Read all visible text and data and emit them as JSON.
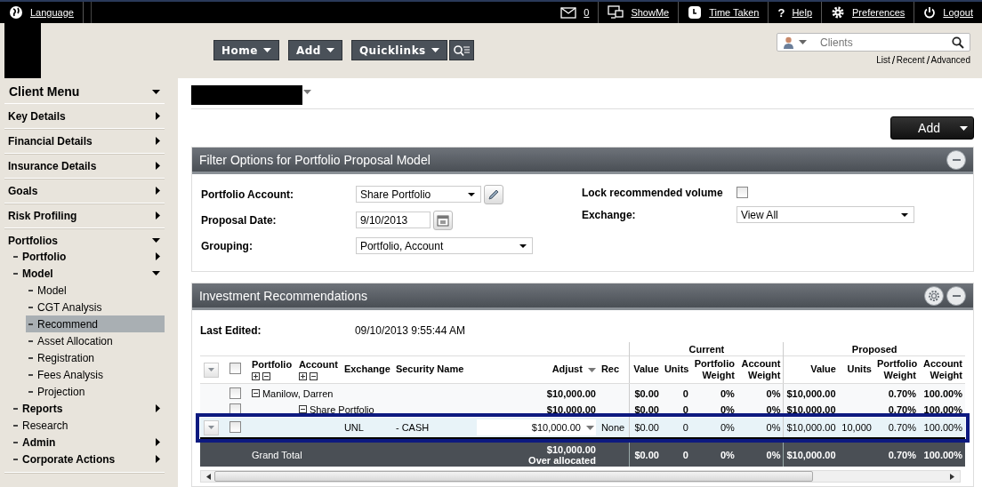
{
  "top_bar": {
    "items": [
      {
        "kind": "language",
        "label": "Language"
      },
      {
        "kind": "mail",
        "label": "0"
      },
      {
        "kind": "showme",
        "label": "ShowMe"
      },
      {
        "kind": "timer",
        "label": "Time Taken"
      },
      {
        "kind": "help",
        "glyph": "?",
        "label": "Help"
      },
      {
        "kind": "settings",
        "label": "Preferences"
      },
      {
        "kind": "logout",
        "label": "Logout"
      }
    ]
  },
  "nav": {
    "buttons": [
      "Home",
      "Add",
      "Quicklinks"
    ],
    "search": {
      "placeholder": "Clients"
    },
    "search_links": [
      "List",
      "Recent",
      "Advanced"
    ]
  },
  "sidebar": {
    "title": "Client Menu",
    "items": [
      {
        "label": "Key Details",
        "kind": "folder",
        "expanded": false,
        "selected": false
      },
      {
        "label": "Financial Details",
        "kind": "folder",
        "expanded": false,
        "selected": false
      },
      {
        "label": "Insurance Details",
        "kind": "folder",
        "expanded": false,
        "selected": false
      },
      {
        "label": "Goals",
        "kind": "folder",
        "expanded": false,
        "selected": false
      },
      {
        "label": "Risk Profiling",
        "kind": "folder",
        "expanded": false,
        "selected": false
      },
      {
        "label": "Portfolios",
        "kind": "folder",
        "expanded": true,
        "selected": false,
        "children": [
          {
            "label": "Portfolio",
            "kind": "folder",
            "expanded": false,
            "selected": false
          },
          {
            "label": "Model",
            "kind": "folder",
            "expanded": true,
            "selected": false,
            "children": [
              {
                "label": "Model",
                "kind": "page",
                "selected": false
              },
              {
                "label": "CGT Analysis",
                "kind": "page",
                "selected": false
              },
              {
                "label": "Recommend",
                "kind": "page",
                "selected": true
              },
              {
                "label": "Asset Allocation",
                "kind": "page",
                "selected": false
              },
              {
                "label": "Registration",
                "kind": "page",
                "selected": false
              },
              {
                "label": "Fees Analysis",
                "kind": "page",
                "selected": false
              },
              {
                "label": "Projection",
                "kind": "page",
                "selected": false
              }
            ]
          },
          {
            "label": "Reports",
            "kind": "folder",
            "expanded": false,
            "selected": false
          },
          {
            "label": "Research",
            "kind": "page",
            "selected": false
          },
          {
            "label": "Admin",
            "kind": "folder",
            "expanded": false,
            "selected": false
          },
          {
            "label": "Corporate Actions",
            "kind": "folder",
            "expanded": false,
            "selected": false
          }
        ]
      }
    ]
  },
  "add_button": "Add",
  "filter_panel": {
    "title": "Filter Options for Portfolio Proposal Model",
    "left_fields": [
      {
        "kind": "select",
        "label": "Portfolio Account:",
        "value": "Share Portfolio",
        "editable": true
      },
      {
        "kind": "date",
        "label": "Proposal Date:",
        "value": "9/10/2013"
      },
      {
        "kind": "select",
        "label": "Grouping:",
        "value": "Portfolio, Account"
      }
    ],
    "right_fields": [
      {
        "kind": "checkbox",
        "label": "Lock recommended volume",
        "checked": false
      },
      {
        "kind": "select",
        "label": "Exchange:",
        "value": "View All"
      }
    ]
  },
  "investment_panel": {
    "title": "Investment Recommendations",
    "last_edited_label": "Last Edited:",
    "last_edited": "09/10/2013 9:55:44 AM",
    "group_headers": [
      "Current",
      "Proposed"
    ],
    "select_all_checked": false,
    "columns": [
      "Portfolio",
      "Account",
      "Exchange",
      "Security Name",
      "Adjust",
      "Rec",
      "Value",
      "Units",
      "Portfolio Weight",
      "Account Weight",
      "Value",
      "Units",
      "Portfolio Weight",
      "Account Weight"
    ],
    "rows": [
      {
        "kind": "portfolio",
        "label": "Manilow, Darren",
        "checked": false,
        "highlighted": false,
        "adjust": "$10,000.00",
        "current": {
          "value": "$0.00",
          "units": "0",
          "portfolio_weight": "0%",
          "account_weight": "0%"
        },
        "proposed": {
          "value": "$10,000.00",
          "portfolio_weight": "0.70%",
          "account_weight": "100.00%"
        }
      },
      {
        "kind": "account",
        "label": "Share Portfolio",
        "checked": false,
        "highlighted": false,
        "adjust": "$10,000.00",
        "current": {
          "value": "$0.00",
          "units": "0",
          "portfolio_weight": "0%",
          "account_weight": "0%"
        },
        "proposed": {
          "value": "$10,000.00",
          "portfolio_weight": "0.70%",
          "account_weight": "100.00%"
        }
      },
      {
        "kind": "security",
        "exchange": "UNL",
        "security": "- CASH",
        "checked": false,
        "highlighted": true,
        "adjust": "$10,000.00",
        "rec": "None",
        "current": {
          "value": "$0.00",
          "units": "0",
          "portfolio_weight": "0%",
          "account_weight": "0%"
        },
        "proposed": {
          "value": "$10,000.00",
          "units": "10,000",
          "portfolio_weight": "0.70%",
          "account_weight": "100.00%"
        }
      },
      {
        "kind": "total",
        "label": "Grand Total",
        "highlighted": false,
        "adjust": "$10,000.00",
        "adjust_note": "Over allocated",
        "current": {
          "value": "$0.00",
          "units": "0",
          "portfolio_weight": "0%",
          "account_weight": "0%"
        },
        "proposed": {
          "value": "$10,000.00",
          "portfolio_weight": "0.70%",
          "account_weight": "100.00%"
        }
      }
    ]
  }
}
